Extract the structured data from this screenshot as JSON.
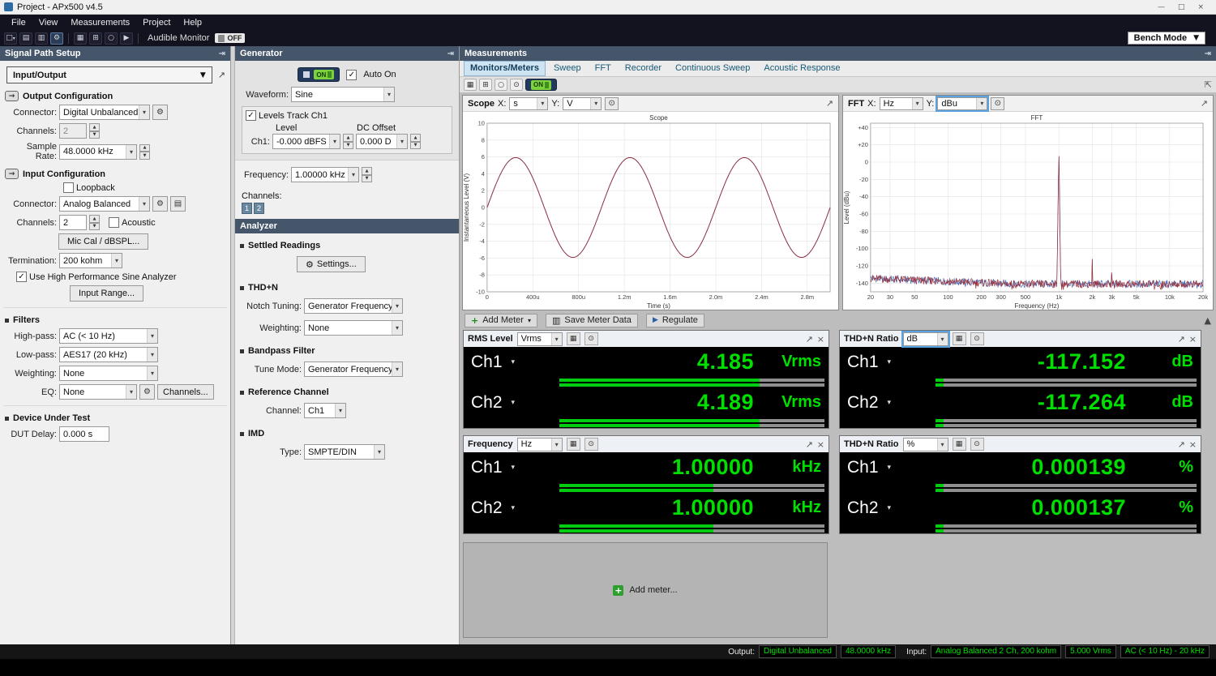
{
  "window": {
    "title": "Project - APx500 v4.5",
    "menu_items": [
      "File",
      "View",
      "Measurements",
      "Project",
      "Help"
    ]
  },
  "toolbar": {
    "audible_monitor_label": "Audible Monitor",
    "off_label": "OFF",
    "bench_mode_label": "Bench Mode"
  },
  "signal_path": {
    "title": "Signal Path Setup",
    "selector_value": "Input/Output",
    "output_config": {
      "title": "Output Configuration",
      "connector_label": "Connector:",
      "connector_value": "Digital Unbalanced",
      "channels_label": "Channels:",
      "channels_value": "2",
      "sample_rate_label": "Sample Rate:",
      "sample_rate_value": "48.0000 kHz"
    },
    "input_config": {
      "title": "Input Configuration",
      "loopback_label": "Loopback",
      "connector_label": "Connector:",
      "connector_value": "Analog Balanced",
      "channels_label": "Channels:",
      "channels_value": "2",
      "acoustic_label": "Acoustic",
      "mic_cal_button": "Mic Cal / dBSPL...",
      "termination_label": "Termination:",
      "termination_value": "200 kohm",
      "high_perf_label": "Use High Performance Sine Analyzer",
      "input_range_button": "Input Range..."
    },
    "filters": {
      "title": "Filters",
      "high_pass_label": "High-pass:",
      "high_pass_value": "AC (< 10 Hz)",
      "low_pass_label": "Low-pass:",
      "low_pass_value": "AES17 (20 kHz)",
      "weighting_label": "Weighting:",
      "weighting_value": "None",
      "eq_label": "EQ:",
      "eq_value": "None",
      "channels_button": "Channels..."
    },
    "dut": {
      "title": "Device Under Test",
      "delay_label": "DUT Delay:",
      "delay_value": "0.000 s"
    }
  },
  "generator": {
    "title": "Generator",
    "on_label": "ON",
    "auto_on_label": "Auto On",
    "waveform_label": "Waveform:",
    "waveform_value": "Sine",
    "levels_track_label": "Levels Track Ch1",
    "level_header": "Level",
    "dc_offset_header": "DC Offset",
    "ch1_label": "Ch1:",
    "level_value": "-0.000 dBFS",
    "dc_offset_value": "0.000 D",
    "frequency_label": "Frequency:",
    "frequency_value": "1.00000 kHz",
    "channels_label": "Channels:",
    "channel_buttons": [
      "1",
      "2"
    ]
  },
  "analyzer": {
    "title": "Analyzer",
    "settled_readings_title": "Settled Readings",
    "settings_button": "Settings...",
    "thdn_title": "THD+N",
    "notch_label": "Notch Tuning:",
    "notch_value": "Generator Frequency",
    "weighting_label": "Weighting:",
    "weighting_value": "None",
    "bandpass_title": "Bandpass Filter",
    "tune_label": "Tune Mode:",
    "tune_value": "Generator Frequency",
    "reference_title": "Reference Channel",
    "channel_label": "Channel:",
    "channel_value": "Ch1",
    "imd_title": "IMD",
    "type_label": "Type:",
    "type_value": "SMPTE/DIN"
  },
  "measurements": {
    "title": "Measurements",
    "tabs": [
      "Monitors/Meters",
      "Sweep",
      "FFT",
      "Recorder",
      "Continuous Sweep",
      "Acoustic Response"
    ],
    "active_tab": "Monitors/Meters",
    "on_label": "ON"
  },
  "scope_panel": {
    "title": "Scope",
    "x_label": "X:",
    "x_value": "s",
    "y_label": "Y:",
    "y_value": "V"
  },
  "fft_panel": {
    "title": "FFT",
    "x_label": "X:",
    "x_value": "Hz",
    "y_label": "Y:",
    "y_value": "dBu"
  },
  "meter_toolbar": {
    "add_meter": "Add Meter",
    "save_meter_data": "Save Meter Data",
    "regulate": "Regulate"
  },
  "meters": [
    {
      "title": "RMS Level",
      "unit": "Vrms",
      "channels": [
        {
          "name": "Ch1",
          "value": "4.185",
          "unit": "Vrms",
          "bar_fraction": 0.755
        },
        {
          "name": "Ch2",
          "value": "4.189",
          "unit": "Vrms",
          "bar_fraction": 0.755
        }
      ]
    },
    {
      "title": "THD+N Ratio",
      "unit": "dB",
      "channels": [
        {
          "name": "Ch1",
          "value": "-117.152",
          "unit": "dB",
          "bar_fraction": 0.03
        },
        {
          "name": "Ch2",
          "value": "-117.264",
          "unit": "dB",
          "bar_fraction": 0.03
        }
      ]
    },
    {
      "title": "Frequency",
      "unit": "Hz",
      "channels": [
        {
          "name": "Ch1",
          "value": "1.00000",
          "unit": "kHz",
          "bar_fraction": 0.58
        },
        {
          "name": "Ch2",
          "value": "1.00000",
          "unit": "kHz",
          "bar_fraction": 0.58
        }
      ]
    },
    {
      "title": "THD+N Ratio",
      "unit": "%",
      "channels": [
        {
          "name": "Ch1",
          "value": "0.000139",
          "unit": "%",
          "bar_fraction": 0.03
        },
        {
          "name": "Ch2",
          "value": "0.000137",
          "unit": "%",
          "bar_fraction": 0.03
        }
      ]
    }
  ],
  "add_meter_label": "Add meter...",
  "status_bar": {
    "output_label": "Output:",
    "output_values": [
      "Digital Unbalanced",
      "48.0000 kHz"
    ],
    "input_label": "Input:",
    "input_values": [
      "Analog Balanced 2 Ch, 200 kohm",
      "5.000 Vrms",
      "AC (< 10 Hz) - 20 kHz"
    ]
  },
  "colors": {
    "meter_green": "#00e000",
    "panel_header": "#45566b",
    "trace_red": "#9c2f38",
    "trace_blue": "#4a6fb5"
  },
  "icons": {
    "caret": "▾",
    "caret_big": "▼",
    "check": "✓",
    "gear": "⚙",
    "spin_up": "▲",
    "spin_down": "▼",
    "close": "×",
    "popout": "↗",
    "dock": "⇥",
    "play": "▶",
    "plus": "+",
    "minimize": "—",
    "maximize": "□",
    "arrow": "→",
    "grid": "▦",
    "rows": "▤",
    "save": "▥",
    "circle": "○",
    "target": "⊙",
    "pin": "⇱",
    "box": "□",
    "grid2": "⊞"
  },
  "chart_data": [
    {
      "type": "line",
      "title": "Scope",
      "xlabel": "Time (s)",
      "ylabel": "Instantaneous Level (V)",
      "xlim": [
        0,
        0.003
      ],
      "ylim": [
        -10,
        10
      ],
      "grid": true,
      "xticks": [
        {
          "v": 0,
          "label": "0"
        },
        {
          "v": 0.0004,
          "label": "400u"
        },
        {
          "v": 0.0008,
          "label": "800u"
        },
        {
          "v": 0.0012,
          "label": "1.2m"
        },
        {
          "v": 0.0016,
          "label": "1.6m"
        },
        {
          "v": 0.002,
          "label": "2.0m"
        },
        {
          "v": 0.0024,
          "label": "2.4m"
        },
        {
          "v": 0.0028,
          "label": "2.8m"
        }
      ],
      "yticks": [
        {
          "v": 10,
          "label": "10"
        },
        {
          "v": 8,
          "label": "8"
        },
        {
          "v": 6,
          "label": "6"
        },
        {
          "v": 4,
          "label": "4"
        },
        {
          "v": 2,
          "label": "2"
        },
        {
          "v": 0,
          "label": "0"
        },
        {
          "v": -2,
          "label": "-2"
        },
        {
          "v": -4,
          "label": "-4"
        },
        {
          "v": -6,
          "label": "-6"
        },
        {
          "v": -8,
          "label": "-8"
        },
        {
          "v": -10,
          "label": "-10"
        }
      ],
      "series": [
        {
          "name": "Ch1",
          "color": "#4a6fb5",
          "waveform": "sine",
          "amplitude_v": 5.92,
          "frequency_hz": 1000
        },
        {
          "name": "Ch2",
          "color": "#9c2f38",
          "waveform": "sine",
          "amplitude_v": 5.92,
          "frequency_hz": 1000
        }
      ]
    },
    {
      "type": "line",
      "x_scale": "log",
      "title": "FFT",
      "xlabel": "Frequency (Hz)",
      "ylabel": "Level (dBu)",
      "xlim": [
        20,
        20000
      ],
      "ylim": [
        -150,
        45
      ],
      "grid": true,
      "xticks": [
        {
          "v": 20,
          "label": "20"
        },
        {
          "v": 30,
          "label": "30"
        },
        {
          "v": 50,
          "label": "50"
        },
        {
          "v": 100,
          "label": "100"
        },
        {
          "v": 200,
          "label": "200"
        },
        {
          "v": 300,
          "label": "300"
        },
        {
          "v": 500,
          "label": "500"
        },
        {
          "v": 1000,
          "label": "1k"
        },
        {
          "v": 2000,
          "label": "2k"
        },
        {
          "v": 3000,
          "label": "3k"
        },
        {
          "v": 5000,
          "label": "5k"
        },
        {
          "v": 10000,
          "label": "10k"
        },
        {
          "v": 20000,
          "label": "20k"
        }
      ],
      "yticks": [
        {
          "v": 40,
          "label": "+40"
        },
        {
          "v": 20,
          "label": "+20"
        },
        {
          "v": 0,
          "label": "0"
        },
        {
          "v": -20,
          "label": "-20"
        },
        {
          "v": -40,
          "label": "-40"
        },
        {
          "v": -60,
          "label": "-60"
        },
        {
          "v": -80,
          "label": "-80"
        },
        {
          "v": -100,
          "label": "-100"
        },
        {
          "v": -120,
          "label": "-120"
        },
        {
          "v": -140,
          "label": "-140"
        }
      ],
      "noise_floor_dbu": -141,
      "fundamental": {
        "frequency_hz": 1000,
        "level_dbu": 16
      },
      "harmonics": [
        {
          "frequency_hz": 2000,
          "level_dbu": -112
        },
        {
          "frequency_hz": 3000,
          "level_dbu": -118
        },
        {
          "frequency_hz": 5000,
          "level_dbu": -124
        }
      ],
      "series": [
        {
          "name": "Ch1",
          "color": "#4a6fb5",
          "seed": 1
        },
        {
          "name": "Ch2",
          "color": "#9c2f38",
          "seed": 2
        }
      ]
    }
  ]
}
